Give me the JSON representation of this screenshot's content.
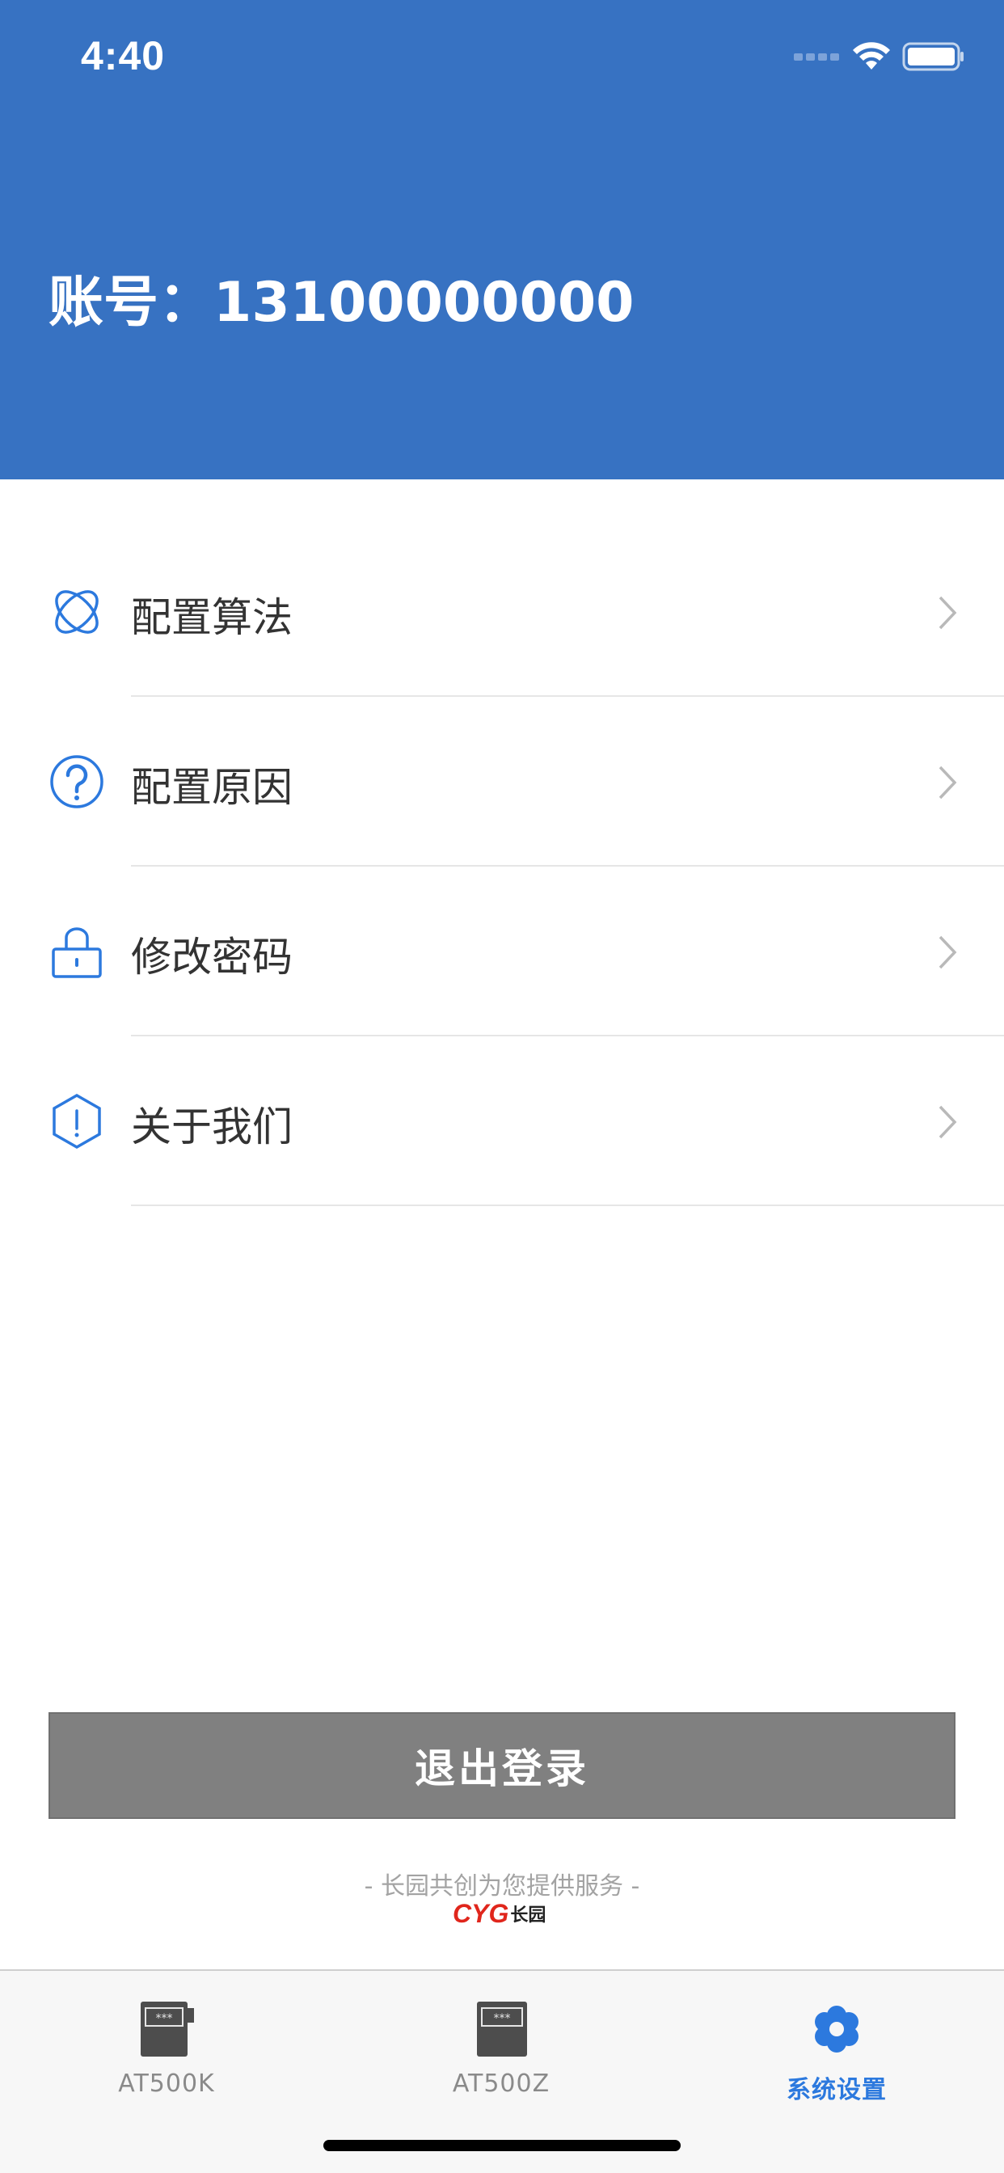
{
  "status_bar": {
    "time": "4:40"
  },
  "header": {
    "account_label": "账号：",
    "account_value": "13100000000"
  },
  "menu": [
    {
      "label": "配置算法",
      "icon": "orbit-icon"
    },
    {
      "label": "配置原因",
      "icon": "question-circle-icon"
    },
    {
      "label": "修改密码",
      "icon": "lock-icon"
    },
    {
      "label": "关于我们",
      "icon": "hexagon-exclamation-icon"
    }
  ],
  "logout_label": "退出登录",
  "footer": {
    "slogan": "- 长园共创为您提供服务 -",
    "brand_logo": "CYG",
    "brand_cn": "长园"
  },
  "tabs": [
    {
      "label": "AT500K",
      "active": false
    },
    {
      "label": "AT500Z",
      "active": false
    },
    {
      "label": "系统设置",
      "active": true
    }
  ],
  "colors": {
    "primary": "#3772c2",
    "tab_active": "#2c79de",
    "logout": "#808080"
  }
}
